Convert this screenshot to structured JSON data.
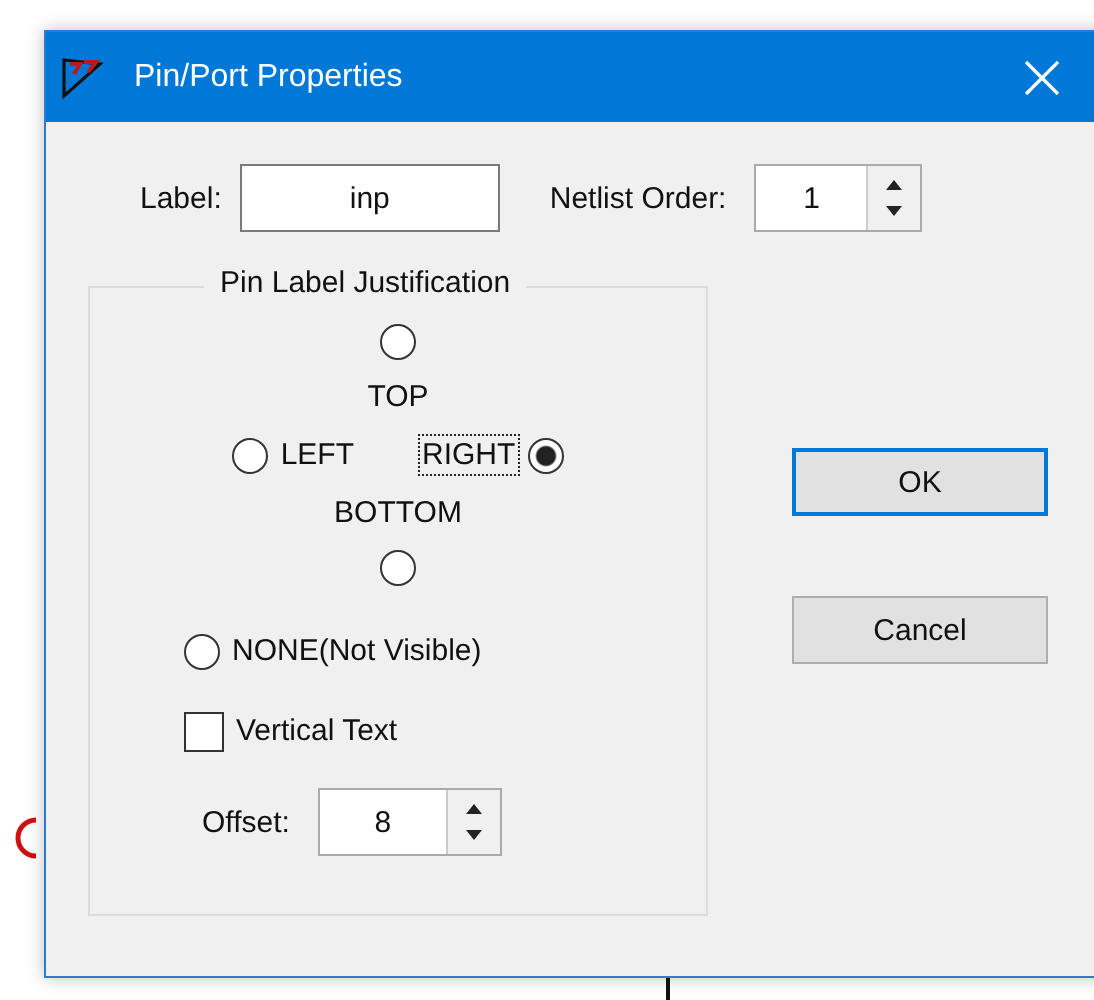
{
  "window": {
    "title": "Pin/Port Properties"
  },
  "label_field": {
    "label": "Label:",
    "value": "inp"
  },
  "netlist_order": {
    "label": "Netlist Order:",
    "value": "1"
  },
  "justification": {
    "title": "Pin Label Justification",
    "options": [
      {
        "kind": "top",
        "label": "TOP",
        "selected": false,
        "focused": false
      },
      {
        "kind": "left",
        "label": "LEFT",
        "selected": false,
        "focused": false
      },
      {
        "kind": "right",
        "label": "RIGHT",
        "selected": true,
        "focused": true
      },
      {
        "kind": "bottom",
        "label": "BOTTOM",
        "selected": false,
        "focused": false
      },
      {
        "kind": "none",
        "label": "NONE(Not Visible)",
        "selected": false,
        "focused": false
      }
    ]
  },
  "vertical_text": {
    "label": "Vertical Text",
    "checked": false
  },
  "offset": {
    "label": "Offset:",
    "value": "8"
  },
  "buttons": [
    {
      "label": "OK",
      "default": true
    },
    {
      "label": "Cancel",
      "default": false
    }
  ]
}
